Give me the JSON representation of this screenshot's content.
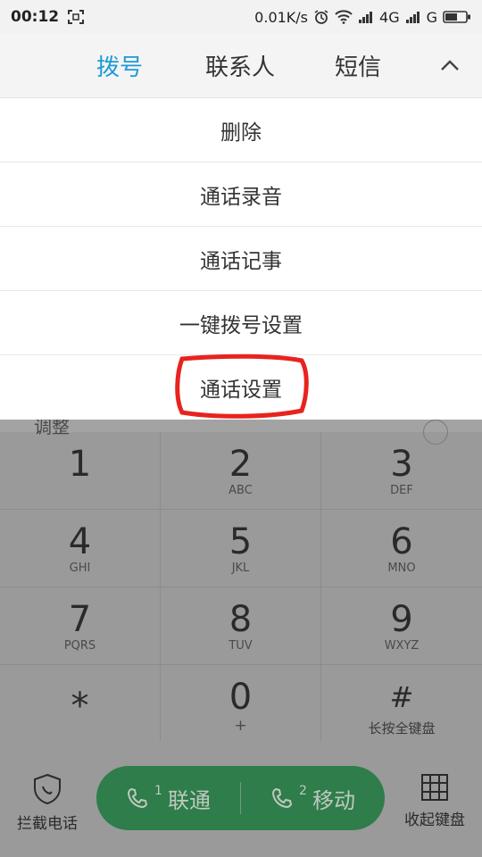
{
  "status_bar": {
    "time": "00:12",
    "net_speed": "0.01K/s",
    "network1": "4G",
    "network2": "G"
  },
  "tabs": [
    {
      "label": "拨号",
      "active": true
    },
    {
      "label": "联系人",
      "active": false
    },
    {
      "label": "短信",
      "active": false
    }
  ],
  "menu": {
    "items": [
      {
        "label": "删除"
      },
      {
        "label": "通话录音"
      },
      {
        "label": "通话记事"
      },
      {
        "label": "一键拨号设置"
      },
      {
        "label": "通话设置"
      }
    ]
  },
  "dialer": {
    "peek_text": "调整",
    "keys": [
      {
        "digit": "1",
        "letters": ""
      },
      {
        "digit": "2",
        "letters": "ABC"
      },
      {
        "digit": "3",
        "letters": "DEF"
      },
      {
        "digit": "4",
        "letters": "GHI"
      },
      {
        "digit": "5",
        "letters": "JKL"
      },
      {
        "digit": "6",
        "letters": "MNO"
      },
      {
        "digit": "7",
        "letters": "PQRS"
      },
      {
        "digit": "8",
        "letters": "TUV"
      },
      {
        "digit": "9",
        "letters": "WXYZ"
      },
      {
        "digit": "*",
        "letters": ""
      },
      {
        "digit": "0",
        "letters": "+"
      },
      {
        "digit": "#",
        "letters": "长按全键盘"
      }
    ]
  },
  "bottom": {
    "block_label": "拦截电话",
    "sim1_num": "1",
    "sim1_label": "联通",
    "sim2_num": "2",
    "sim2_label": "移动",
    "collapse_label": "收起键盘"
  },
  "colors": {
    "accent": "#1e9ad6",
    "highlight": "#e8231f",
    "call_green": "#2e7d4a"
  }
}
